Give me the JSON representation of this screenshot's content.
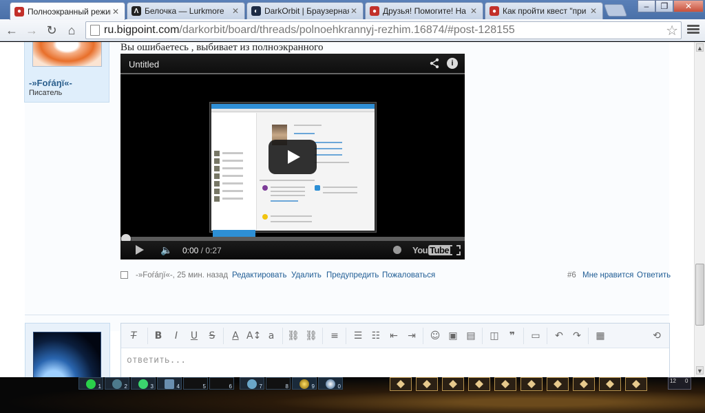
{
  "browser": {
    "tabs": [
      {
        "title": "Полноэкранный режим",
        "active": true,
        "icon_color": "#c2302a",
        "icon": "bp-icon"
      },
      {
        "title": "Белочка — Lurkmore",
        "active": false,
        "icon_color": "#222222",
        "icon": "lurkmore-icon"
      },
      {
        "title": "DarkOrbit | Браузерная",
        "active": false,
        "icon_color": "#1c2b45",
        "icon": "darkorbit-icon"
      },
      {
        "title": "Друзья! Помогите! На F",
        "active": false,
        "icon_color": "#c2302a",
        "icon": "bp-icon"
      },
      {
        "title": "Как пройти квест \"при",
        "active": false,
        "icon_color": "#c2302a",
        "icon": "bp-icon"
      }
    ],
    "address": {
      "host": "ru.bigpoint.com",
      "path": "/darkorbit/board/threads/polnoehkrannyj-rezhim.16874/#post-128155"
    }
  },
  "post": {
    "author": {
      "name": "-»Foŕáŋï«-",
      "title": "Писатель"
    },
    "text": "Вы ошибаетесь , выбивает из полноэкранного",
    "video": {
      "title": "Untitled",
      "current_time": "0:00",
      "duration": "/ 0:27",
      "progress": 0,
      "youtube_label": "You",
      "youtube_box": "Tube"
    },
    "meta": "-»Foŕáŋï«-, 25 мин. назад",
    "actions": {
      "edit": "Редактировать",
      "delete": "Удалить",
      "warn": "Предупредить",
      "report": "Пожаловаться",
      "number": "#6",
      "like": "Мне нравится",
      "reply": "Ответить"
    }
  },
  "reply": {
    "placeholder": "ответить..."
  },
  "gamebar": {
    "left_slots": [
      "1",
      "2",
      "3",
      "4",
      "5",
      "6",
      "7",
      "8",
      "9",
      "0"
    ],
    "right_numbers": [
      "12",
      "0"
    ]
  },
  "colors": {
    "link": "#1f5c94",
    "accent": "#2a5e8c",
    "chrome": "#4a70a8"
  }
}
